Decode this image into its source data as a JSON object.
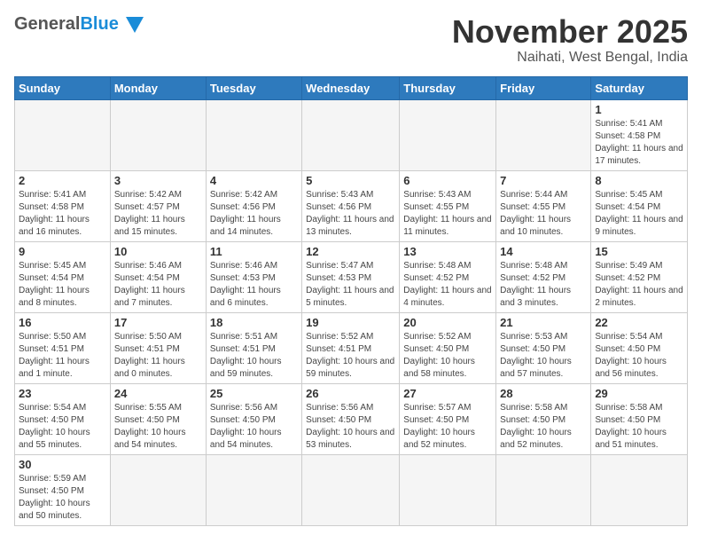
{
  "header": {
    "logo_general": "General",
    "logo_blue": "Blue",
    "month_title": "November 2025",
    "location": "Naihati, West Bengal, India"
  },
  "weekdays": [
    "Sunday",
    "Monday",
    "Tuesday",
    "Wednesday",
    "Thursday",
    "Friday",
    "Saturday"
  ],
  "days": [
    {
      "num": "",
      "info": ""
    },
    {
      "num": "",
      "info": ""
    },
    {
      "num": "",
      "info": ""
    },
    {
      "num": "",
      "info": ""
    },
    {
      "num": "",
      "info": ""
    },
    {
      "num": "",
      "info": ""
    },
    {
      "num": "1",
      "info": "Sunrise: 5:41 AM\nSunset: 4:58 PM\nDaylight: 11 hours and 17 minutes."
    },
    {
      "num": "2",
      "info": "Sunrise: 5:41 AM\nSunset: 4:58 PM\nDaylight: 11 hours and 16 minutes."
    },
    {
      "num": "3",
      "info": "Sunrise: 5:42 AM\nSunset: 4:57 PM\nDaylight: 11 hours and 15 minutes."
    },
    {
      "num": "4",
      "info": "Sunrise: 5:42 AM\nSunset: 4:56 PM\nDaylight: 11 hours and 14 minutes."
    },
    {
      "num": "5",
      "info": "Sunrise: 5:43 AM\nSunset: 4:56 PM\nDaylight: 11 hours and 13 minutes."
    },
    {
      "num": "6",
      "info": "Sunrise: 5:43 AM\nSunset: 4:55 PM\nDaylight: 11 hours and 11 minutes."
    },
    {
      "num": "7",
      "info": "Sunrise: 5:44 AM\nSunset: 4:55 PM\nDaylight: 11 hours and 10 minutes."
    },
    {
      "num": "8",
      "info": "Sunrise: 5:45 AM\nSunset: 4:54 PM\nDaylight: 11 hours and 9 minutes."
    },
    {
      "num": "9",
      "info": "Sunrise: 5:45 AM\nSunset: 4:54 PM\nDaylight: 11 hours and 8 minutes."
    },
    {
      "num": "10",
      "info": "Sunrise: 5:46 AM\nSunset: 4:54 PM\nDaylight: 11 hours and 7 minutes."
    },
    {
      "num": "11",
      "info": "Sunrise: 5:46 AM\nSunset: 4:53 PM\nDaylight: 11 hours and 6 minutes."
    },
    {
      "num": "12",
      "info": "Sunrise: 5:47 AM\nSunset: 4:53 PM\nDaylight: 11 hours and 5 minutes."
    },
    {
      "num": "13",
      "info": "Sunrise: 5:48 AM\nSunset: 4:52 PM\nDaylight: 11 hours and 4 minutes."
    },
    {
      "num": "14",
      "info": "Sunrise: 5:48 AM\nSunset: 4:52 PM\nDaylight: 11 hours and 3 minutes."
    },
    {
      "num": "15",
      "info": "Sunrise: 5:49 AM\nSunset: 4:52 PM\nDaylight: 11 hours and 2 minutes."
    },
    {
      "num": "16",
      "info": "Sunrise: 5:50 AM\nSunset: 4:51 PM\nDaylight: 11 hours and 1 minute."
    },
    {
      "num": "17",
      "info": "Sunrise: 5:50 AM\nSunset: 4:51 PM\nDaylight: 11 hours and 0 minutes."
    },
    {
      "num": "18",
      "info": "Sunrise: 5:51 AM\nSunset: 4:51 PM\nDaylight: 10 hours and 59 minutes."
    },
    {
      "num": "19",
      "info": "Sunrise: 5:52 AM\nSunset: 4:51 PM\nDaylight: 10 hours and 59 minutes."
    },
    {
      "num": "20",
      "info": "Sunrise: 5:52 AM\nSunset: 4:50 PM\nDaylight: 10 hours and 58 minutes."
    },
    {
      "num": "21",
      "info": "Sunrise: 5:53 AM\nSunset: 4:50 PM\nDaylight: 10 hours and 57 minutes."
    },
    {
      "num": "22",
      "info": "Sunrise: 5:54 AM\nSunset: 4:50 PM\nDaylight: 10 hours and 56 minutes."
    },
    {
      "num": "23",
      "info": "Sunrise: 5:54 AM\nSunset: 4:50 PM\nDaylight: 10 hours and 55 minutes."
    },
    {
      "num": "24",
      "info": "Sunrise: 5:55 AM\nSunset: 4:50 PM\nDaylight: 10 hours and 54 minutes."
    },
    {
      "num": "25",
      "info": "Sunrise: 5:56 AM\nSunset: 4:50 PM\nDaylight: 10 hours and 54 minutes."
    },
    {
      "num": "26",
      "info": "Sunrise: 5:56 AM\nSunset: 4:50 PM\nDaylight: 10 hours and 53 minutes."
    },
    {
      "num": "27",
      "info": "Sunrise: 5:57 AM\nSunset: 4:50 PM\nDaylight: 10 hours and 52 minutes."
    },
    {
      "num": "28",
      "info": "Sunrise: 5:58 AM\nSunset: 4:50 PM\nDaylight: 10 hours and 52 minutes."
    },
    {
      "num": "29",
      "info": "Sunrise: 5:58 AM\nSunset: 4:50 PM\nDaylight: 10 hours and 51 minutes."
    },
    {
      "num": "30",
      "info": "Sunrise: 5:59 AM\nSunset: 4:50 PM\nDaylight: 10 hours and 50 minutes."
    },
    {
      "num": "",
      "info": ""
    },
    {
      "num": "",
      "info": ""
    },
    {
      "num": "",
      "info": ""
    },
    {
      "num": "",
      "info": ""
    },
    {
      "num": "",
      "info": ""
    },
    {
      "num": "",
      "info": ""
    }
  ]
}
